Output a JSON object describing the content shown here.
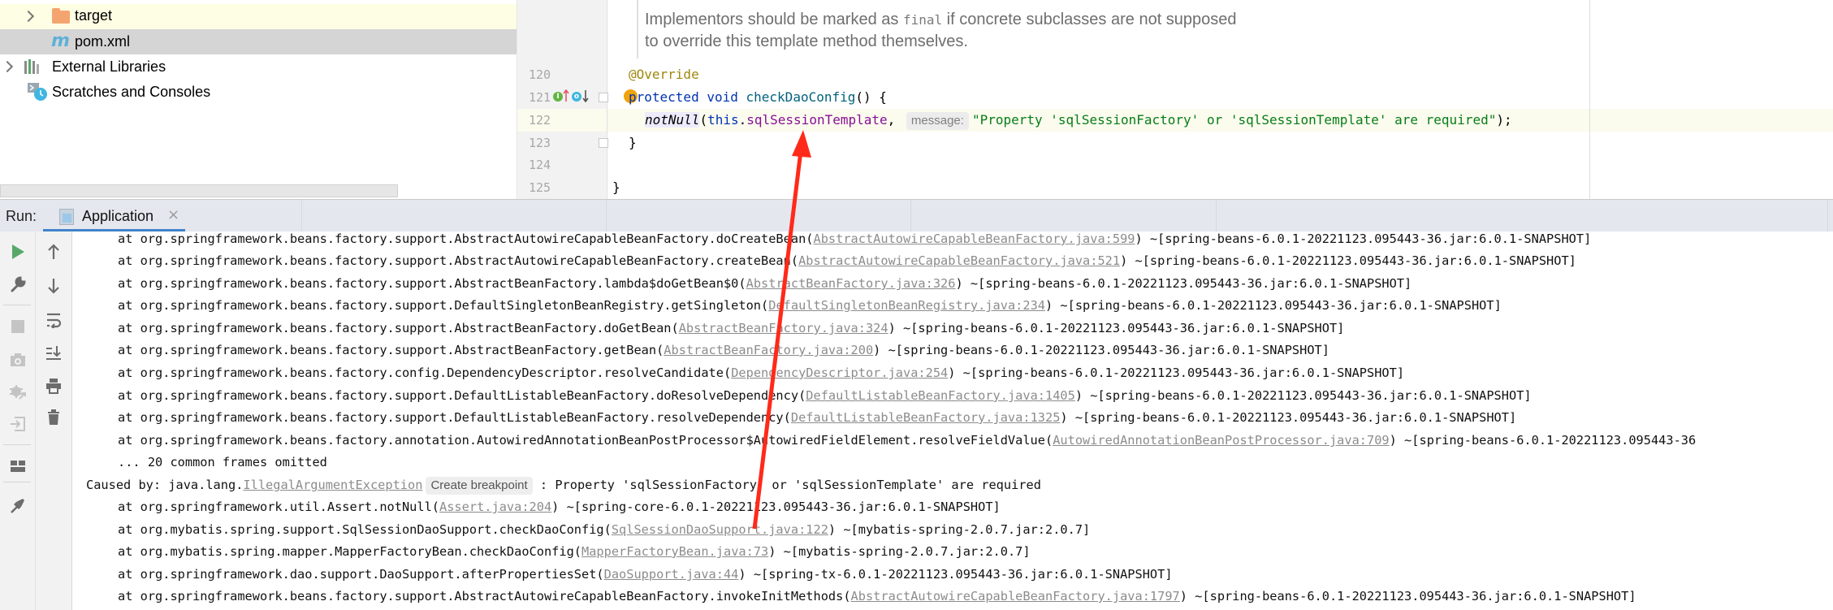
{
  "project_tree": {
    "items": [
      {
        "label": "target",
        "icon": "folder-icon",
        "expandable": true
      },
      {
        "label": "pom.xml",
        "icon": "maven-icon",
        "expandable": false
      },
      {
        "label": "External Libraries",
        "icon": "libraries-icon",
        "expandable": true
      },
      {
        "label": "Scratches and Consoles",
        "icon": "scratches-icon",
        "expandable": false
      }
    ]
  },
  "editor": {
    "doc_comment": {
      "line1_before": "Implementors should be marked as ",
      "line1_code": "final",
      "line1_after": " if concrete subclasses are not supposed",
      "line2": "to override this template method themselves."
    },
    "line_numbers": [
      "120",
      "121",
      "122",
      "123",
      "124",
      "125"
    ],
    "lines": {
      "l120": {
        "annotation": "@Override"
      },
      "l121": {
        "kw1": "protected",
        "kw2": "void",
        "method": "checkDaoConfig",
        "rest": "() {"
      },
      "l122": {
        "call": "notNull",
        "open": "(",
        "this_kw": "this",
        "dot": ".",
        "field": "sqlSessionTemplate",
        "comma": ", ",
        "hint": "message:",
        "string": "\"Property 'sqlSessionFactory' or 'sqlSessionTemplate' are required\"",
        "close": ");"
      },
      "l123": {
        "text": "}"
      },
      "l124": {
        "text": ""
      },
      "l125": {
        "text": "}"
      }
    },
    "gutter_icons": {
      "implements_marker": "I",
      "overrides_marker": "o"
    }
  },
  "run_panel": {
    "label": "Run:",
    "tab_label": "Application",
    "tab_close": "×",
    "toolbar_left": [
      {
        "name": "rerun-icon",
        "glyph": "▶",
        "enabled": true
      },
      {
        "name": "wrench-icon",
        "glyph": "🔧",
        "enabled": true
      },
      {
        "name": "stop-icon",
        "glyph": "■",
        "enabled": false
      },
      {
        "name": "camera-icon",
        "glyph": "◙",
        "enabled": false
      },
      {
        "name": "debug-exit-icon",
        "glyph": "✲",
        "enabled": false
      },
      {
        "name": "import-icon",
        "glyph": "⇥",
        "enabled": false
      },
      {
        "name": "layout-icon",
        "glyph": "▀",
        "enabled": true
      },
      {
        "name": "pin-icon",
        "glyph": "📌",
        "enabled": true
      }
    ],
    "toolbar_right": [
      {
        "name": "arrow-up-icon",
        "glyph": "↑"
      },
      {
        "name": "arrow-down-icon",
        "glyph": "↓"
      },
      {
        "name": "soft-wrap-icon",
        "glyph": "⤶"
      },
      {
        "name": "scroll-to-end-icon",
        "glyph": "⤓"
      },
      {
        "name": "print-icon",
        "glyph": "⎙"
      },
      {
        "name": "trash-icon",
        "glyph": "🗑"
      }
    ]
  },
  "console": {
    "lines": [
      {
        "type": "frame",
        "prefix": "at org.springframework.beans.factory.support.AbstractAutowireCapableBeanFactory.doCreateBean(",
        "link": "AbstractAutowireCapableBeanFactory.java:599",
        "suffix": ") ~[spring-beans-6.0.1-20221123.095443-36.jar:6.0.1-SNAPSHOT]"
      },
      {
        "type": "frame",
        "prefix": "at org.springframework.beans.factory.support.AbstractAutowireCapableBeanFactory.createBean(",
        "link": "AbstractAutowireCapableBeanFactory.java:521",
        "suffix": ") ~[spring-beans-6.0.1-20221123.095443-36.jar:6.0.1-SNAPSHOT]"
      },
      {
        "type": "frame",
        "prefix": "at org.springframework.beans.factory.support.AbstractBeanFactory.lambda$doGetBean$0(",
        "link": "AbstractBeanFactory.java:326",
        "suffix": ") ~[spring-beans-6.0.1-20221123.095443-36.jar:6.0.1-SNAPSHOT]"
      },
      {
        "type": "frame",
        "prefix": "at org.springframework.beans.factory.support.DefaultSingletonBeanRegistry.getSingleton(",
        "link": "DefaultSingletonBeanRegistry.java:234",
        "suffix": ") ~[spring-beans-6.0.1-20221123.095443-36.jar:6.0.1-SNAPSHOT]"
      },
      {
        "type": "frame",
        "prefix": "at org.springframework.beans.factory.support.AbstractBeanFactory.doGetBean(",
        "link": "AbstractBeanFactory.java:324",
        "suffix": ") ~[spring-beans-6.0.1-20221123.095443-36.jar:6.0.1-SNAPSHOT]"
      },
      {
        "type": "frame",
        "prefix": "at org.springframework.beans.factory.support.AbstractBeanFactory.getBean(",
        "link": "AbstractBeanFactory.java:200",
        "suffix": ") ~[spring-beans-6.0.1-20221123.095443-36.jar:6.0.1-SNAPSHOT]"
      },
      {
        "type": "frame",
        "prefix": "at org.springframework.beans.factory.config.DependencyDescriptor.resolveCandidate(",
        "link": "DependencyDescriptor.java:254",
        "suffix": ") ~[spring-beans-6.0.1-20221123.095443-36.jar:6.0.1-SNAPSHOT]"
      },
      {
        "type": "frame",
        "prefix": "at org.springframework.beans.factory.support.DefaultListableBeanFactory.doResolveDependency(",
        "link": "DefaultListableBeanFactory.java:1405",
        "suffix": ") ~[spring-beans-6.0.1-20221123.095443-36.jar:6.0.1-SNAPSHOT]"
      },
      {
        "type": "frame",
        "prefix": "at org.springframework.beans.factory.support.DefaultListableBeanFactory.resolveDependency(",
        "link": "DefaultListableBeanFactory.java:1325",
        "suffix": ") ~[spring-beans-6.0.1-20221123.095443-36.jar:6.0.1-SNAPSHOT]"
      },
      {
        "type": "frame",
        "prefix": "at org.springframework.beans.factory.annotation.AutowiredAnnotationBeanPostProcessor$AutowiredFieldElement.resolveFieldValue(",
        "link": "AutowiredAnnotationBeanPostProcessor.java:709",
        "suffix": ") ~[spring-beans-6.0.1-20221123.095443-36"
      },
      {
        "type": "plain",
        "text": "... 20 common frames omitted"
      },
      {
        "type": "cause",
        "prefix": "Caused by: java.lang.",
        "link": "IllegalArgumentException",
        "chip": "Create breakpoint",
        "suffix": " : Property 'sqlSessionFactory' or 'sqlSessionTemplate' are required"
      },
      {
        "type": "frame",
        "prefix": "at org.springframework.util.Assert.notNull(",
        "link": "Assert.java:204",
        "suffix": ") ~[spring-core-6.0.1-20221123.095443-36.jar:6.0.1-SNAPSHOT]"
      },
      {
        "type": "frame",
        "prefix": "at org.mybatis.spring.support.SqlSessionDaoSupport.checkDaoConfig(",
        "link": "SqlSessionDaoSupport.java:122",
        "suffix": ") ~[mybatis-spring-2.0.7.jar:2.0.7]"
      },
      {
        "type": "frame",
        "prefix": "at org.mybatis.spring.mapper.MapperFactoryBean.checkDaoConfig(",
        "link": "MapperFactoryBean.java:73",
        "suffix": ") ~[mybatis-spring-2.0.7.jar:2.0.7]"
      },
      {
        "type": "frame",
        "prefix": "at org.springframework.dao.support.DaoSupport.afterPropertiesSet(",
        "link": "DaoSupport.java:44",
        "suffix": ") ~[spring-tx-6.0.1-20221123.095443-36.jar:6.0.1-SNAPSHOT]"
      },
      {
        "type": "frame",
        "prefix": "at org.springframework.beans.factory.support.AbstractAutowireCapableBeanFactory.invokeInitMethods(",
        "link": "AbstractAutowireCapableBeanFactory.java:1797",
        "suffix": ") ~[spring-beans-6.0.1-20221123.095443-36.jar:6.0.1-SNAPSHOT]"
      }
    ]
  },
  "annotation_overlay": {
    "type": "arrow",
    "color": "#ff2a1a",
    "points_from": "console line 'SqlSessionDaoSupport.java:122'",
    "points_to": "editor field 'sqlSessionTemplate' on line 122"
  },
  "colors": {
    "accent": "#4083c9",
    "string": "#067d17",
    "keyword": "#0033b3",
    "field": "#871094",
    "annotation": "#9e880d",
    "link": "#8c8c8c",
    "arrow": "#ff2a1a"
  }
}
